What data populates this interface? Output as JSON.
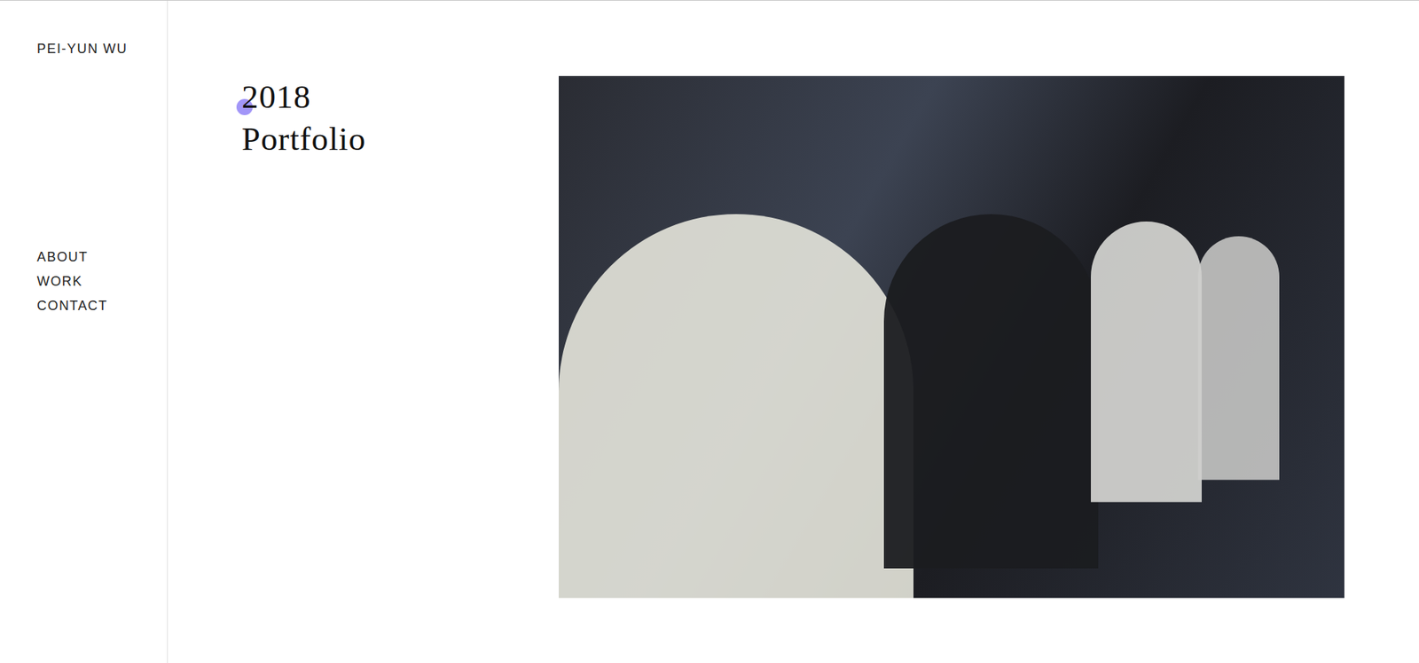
{
  "site": {
    "name": "PEI-YUN WU"
  },
  "nav": {
    "items": [
      {
        "label": "ABOUT",
        "selected": false
      },
      {
        "label": "WORK",
        "selected": false
      },
      {
        "label": "CONTACT",
        "selected": false
      }
    ]
  },
  "project": {
    "title_lines": [
      "2018",
      "Portfolio"
    ]
  }
}
